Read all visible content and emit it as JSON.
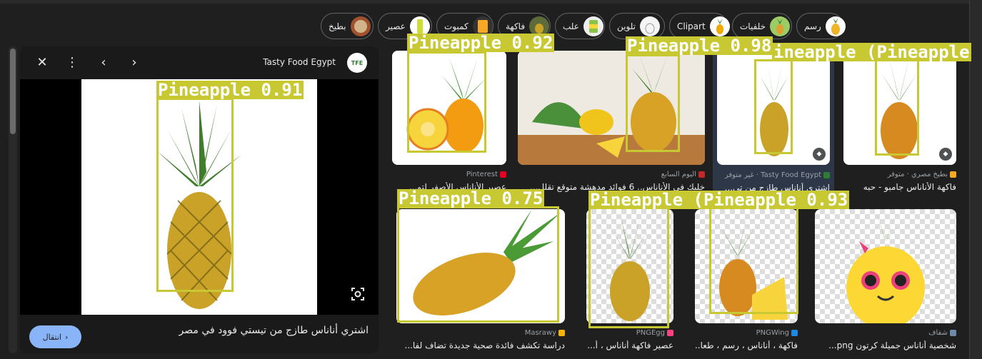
{
  "chips": [
    {
      "label": "رسم",
      "thumb": "pineapple-drawing"
    },
    {
      "label": "خلفيات",
      "thumb": "pineapple-green"
    },
    {
      "label": "Clipart",
      "thumb": "pineapple-clipart"
    },
    {
      "label": "تلوين",
      "thumb": "coloring"
    },
    {
      "label": "علب",
      "thumb": "can"
    },
    {
      "label": "فاكهة",
      "thumb": "fruit"
    },
    {
      "label": "كمبوت",
      "thumb": "compote"
    },
    {
      "label": "عصير",
      "thumb": "juice"
    },
    {
      "label": "بطيخ",
      "thumb": "melon"
    }
  ],
  "panel": {
    "source": "Tasty Food Egypt",
    "logo_text": "TFE",
    "title": "اشتري أناناس طازج من تيستي فوود في مصر",
    "visit_label": "انتقال",
    "close_icon": "close-icon",
    "more_icon": "more-vert-icon",
    "prev_icon": "chevron-left-icon",
    "next_icon": "chevron-right-icon",
    "lens_icon": "lens-icon"
  },
  "results": [
    {
      "source": "Pinterest",
      "title": "عصير الأناناس الأصفر لتو...",
      "fav_color": "#e60023"
    },
    {
      "source": "اليوم السابع",
      "title": "خليك في الأناناس.. 6 فوائد مدهشة متوقع تقلل...",
      "fav_color": "#c62828"
    },
    {
      "source": "Tasty Food Egypt · غير متوفر",
      "title": "اشتري أناناس طازج من تي...",
      "fav_color": "#2e7d32"
    },
    {
      "source": "بطيخ مصري · متوفر",
      "title": "فاكهة الأناناس جامبو - حبه",
      "fav_color": "#f9a825"
    },
    {
      "source": "Masrawy",
      "title": "دراسة تكشف فائدة صحية جديدة تضاف لفا...",
      "fav_color": "#f4b400"
    },
    {
      "source": "PNGEgg",
      "title": "عصير فاكهة أناناس ، أ...",
      "fav_color": "#ff4081"
    },
    {
      "source": "PNGWing",
      "title": "فاكهة ، أناناس ، رسم ، طعا...",
      "fav_color": "#1e88e5"
    },
    {
      "source": "شفاف",
      "title": "شخصية أناناس جميلة كرتون png...",
      "fav_color": "#6d8aa8"
    }
  ],
  "detections": [
    {
      "label": "Pineapple 0.91"
    },
    {
      "label": "Pineapple 0.92"
    },
    {
      "label": "Pineapple 0.98"
    },
    {
      "label": "ineapple (Pineapple"
    },
    {
      "label": "Pineapple 0.75"
    },
    {
      "label": "Pineapple (Pineapple 0.93"
    }
  ],
  "colors": {
    "accent": "#8ab4f8",
    "detection": "#c8c832",
    "background": "#1f1f1f"
  }
}
